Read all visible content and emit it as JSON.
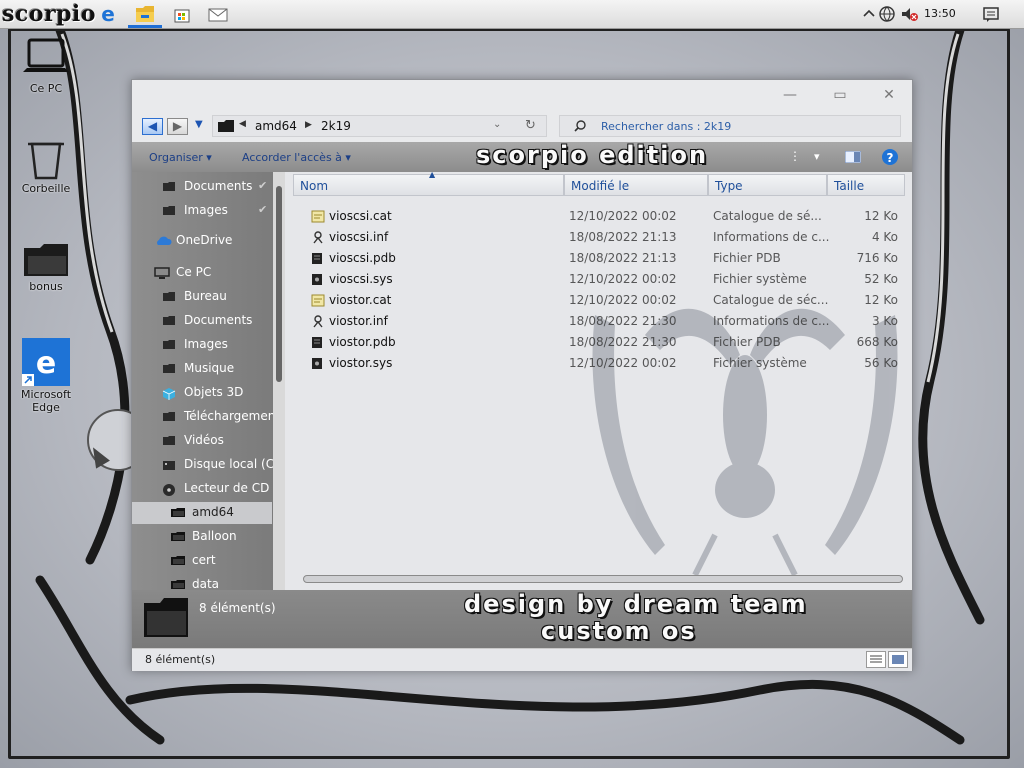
{
  "taskbar": {
    "start_logo": "scorpio",
    "pinned": [
      "edge-icon",
      "file-explorer-icon",
      "store-icon",
      "mail-icon"
    ],
    "clock": "13:50"
  },
  "desktop": {
    "icons": [
      {
        "label": "Ce PC"
      },
      {
        "label": "Corbeille"
      },
      {
        "label": "bonus"
      },
      {
        "label": "Microsoft Edge"
      }
    ]
  },
  "window": {
    "minimize": "—",
    "maximize": "▭",
    "close": "✕",
    "address": {
      "crumbs": [
        "amd64",
        "2k19"
      ]
    },
    "search_placeholder": "Rechercher dans : 2k19",
    "commands": {
      "organize": "Organiser",
      "share": "Accorder l'accès à"
    },
    "brand_top": "scorpio edition",
    "brand_bottom_1": "design by dream team",
    "brand_bottom_2": "custom os",
    "columns": {
      "name": "Nom",
      "modified": "Modifié le",
      "type": "Type",
      "size": "Taille"
    },
    "nav": [
      {
        "label": "Documents",
        "icon": "folder",
        "pinned": true
      },
      {
        "label": "Images",
        "icon": "folder",
        "pinned": true
      },
      {
        "label": "OneDrive",
        "icon": "cloud"
      },
      {
        "label": "Ce PC",
        "icon": "pc"
      },
      {
        "label": "Bureau",
        "icon": "folder"
      },
      {
        "label": "Documents",
        "icon": "folder"
      },
      {
        "label": "Images",
        "icon": "folder"
      },
      {
        "label": "Musique",
        "icon": "folder"
      },
      {
        "label": "Objets 3D",
        "icon": "cube"
      },
      {
        "label": "Téléchargements",
        "icon": "folder"
      },
      {
        "label": "Vidéos",
        "icon": "folder"
      },
      {
        "label": "Disque local (C:)",
        "icon": "drive"
      },
      {
        "label": "Lecteur de CD (D:)",
        "icon": "cd"
      },
      {
        "label": "amd64",
        "icon": "folder-open",
        "selected": true
      },
      {
        "label": "Balloon",
        "icon": "folder-open"
      },
      {
        "label": "cert",
        "icon": "folder-open"
      },
      {
        "label": "data",
        "icon": "folder-open"
      }
    ],
    "files": [
      {
        "name": "vioscsi.cat",
        "modified": "12/10/2022 00:02",
        "type": "Catalogue de sé...",
        "size": "12 Ko",
        "icon": "cat"
      },
      {
        "name": "vioscsi.inf",
        "modified": "18/08/2022 21:13",
        "type": "Informations de c...",
        "size": "4 Ko",
        "icon": "inf"
      },
      {
        "name": "vioscsi.pdb",
        "modified": "18/08/2022 21:13",
        "type": "Fichier PDB",
        "size": "716 Ko",
        "icon": "pdb"
      },
      {
        "name": "vioscsi.sys",
        "modified": "12/10/2022 00:02",
        "type": "Fichier système",
        "size": "52 Ko",
        "icon": "sys"
      },
      {
        "name": "viostor.cat",
        "modified": "12/10/2022 00:02",
        "type": "Catalogue de séc...",
        "size": "12 Ko",
        "icon": "cat"
      },
      {
        "name": "viostor.inf",
        "modified": "18/08/2022 21:30",
        "type": "Informations de c...",
        "size": "3 Ko",
        "icon": "inf"
      },
      {
        "name": "viostor.pdb",
        "modified": "18/08/2022 21:30",
        "type": "Fichier PDB",
        "size": "668 Ko",
        "icon": "pdb"
      },
      {
        "name": "viostor.sys",
        "modified": "12/10/2022 00:02",
        "type": "Fichier système",
        "size": "56 Ko",
        "icon": "sys"
      }
    ],
    "details_count": "8 élément(s)",
    "status_count": "8 élément(s)"
  }
}
